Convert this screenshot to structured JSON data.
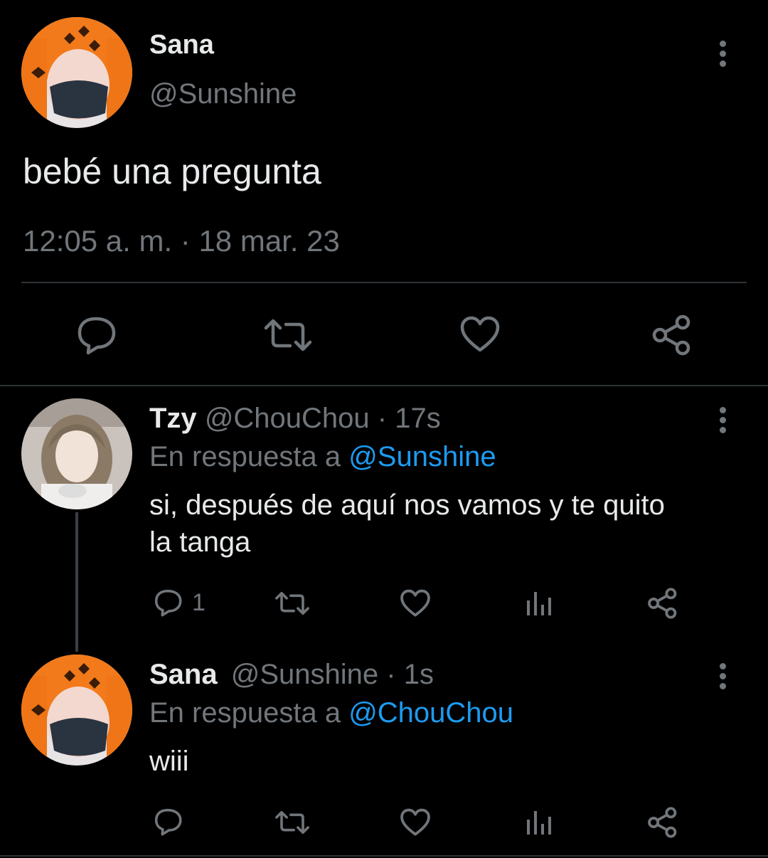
{
  "main_tweet": {
    "display_name": "Sana",
    "handle": "@Sunshine",
    "text": "bebé una pregunta",
    "timestamp": "12:05 a. m. · 18 mar. 23",
    "actions": [
      "reply-icon",
      "retweet-icon",
      "like-icon",
      "share-icon"
    ]
  },
  "replies": [
    {
      "display_name": "Tzy",
      "handle": "@ChouChou",
      "time": "· 17s",
      "in_reply_prefix": "En respuesta a",
      "in_reply_to": "@Sunshine",
      "text_line1": "si, después de aquí nos vamos y te quito",
      "text_line2": "la tanga",
      "reply_count": "1"
    },
    {
      "display_name": "Sana",
      "handle": "@Sunshine",
      "time": "· 1s",
      "in_reply_prefix": "En respuesta a",
      "in_reply_to": "@ChouChou",
      "text_line1": "wiii",
      "reply_count": ""
    }
  ],
  "colors": {
    "background": "#000000",
    "text": "#e7e9ea",
    "secondary": "#71767b",
    "link": "#1d9bf0",
    "avatar_hair": "#f27a1a"
  }
}
